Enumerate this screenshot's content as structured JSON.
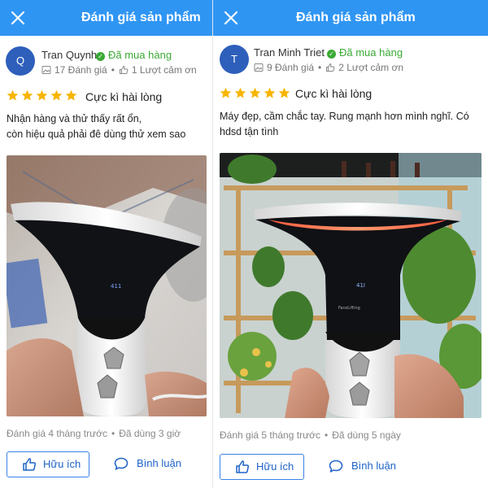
{
  "left": {
    "header_title": "Đánh giá sản phẩm",
    "avatar_initial": "Q",
    "user_name": "Tran Quynh",
    "verified_label": "Đã mua hàng",
    "review_count": "17 Đánh giá",
    "thanks_count": "1 Lượt cảm ơn",
    "stars": 5,
    "rating_label": "Cực kì hài lòng",
    "review_line1": "Nhận hàng và thử thấy rất ổn,",
    "review_line2": "còn hiệu quả phải đê dùng thử xem sao",
    "time_posted": "Đánh giá 4 tháng trước",
    "usage_time": "Đã dùng 3 giờ",
    "helpful_label": "Hữu ích",
    "comment_label": "Bình luận"
  },
  "right": {
    "header_title": "Đánh giá sản phẩm",
    "avatar_initial": "T",
    "user_name": "Tran Minh Triet",
    "verified_label": "Đã mua hàng",
    "review_count": "9 Đánh giá",
    "thanks_count": "2 Lượt cảm ơn",
    "stars": 5,
    "rating_label": "Cực kì hài lòng",
    "review_line1": "Máy đẹp, cầm chắc tay. Rung mạnh hơn mình nghĩ. Có",
    "review_line2": "hdsd tận tình",
    "time_posted": "Đánh giá 5 tháng trước",
    "usage_time": "Đã dùng 5 ngày",
    "helpful_label": "Hữu ích",
    "comment_label": "Bình luận"
  },
  "separator": "•",
  "colors": {
    "header_bg": "#2f95f3",
    "verified_green": "#3aaa35",
    "star_yellow": "#f7b500",
    "link_blue": "#1e63c7",
    "avatar_blue": "#2d5fbb"
  },
  "icons": {
    "close": "close-icon",
    "verified": "check-circle-icon",
    "reviews": "image-icon",
    "thanks": "thumbs-up-icon",
    "star": "star-icon",
    "comment": "chat-bubble-icon"
  }
}
